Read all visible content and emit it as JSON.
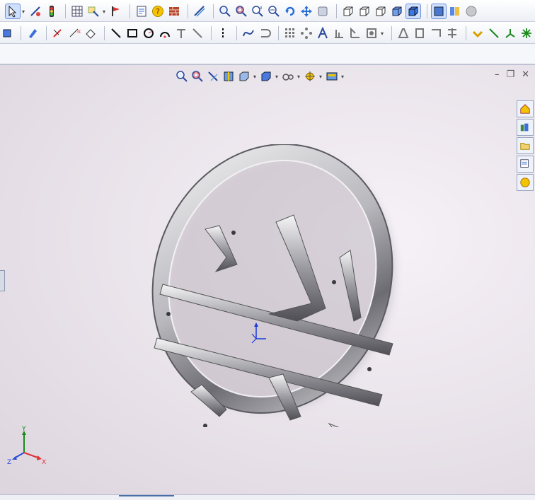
{
  "toolbar_1": {
    "buttons": [
      "select-icon",
      "smart-dimension-icon",
      "traffic-light-icon",
      "grid-icon",
      "sketch-icon",
      "flag-icon",
      "properties-icon",
      "help-icon",
      "wall-icon",
      "measure-icon",
      "zoom-to-fit-icon",
      "zoom-to-area-icon",
      "zoom-in-out-icon",
      "zoom-selection-icon",
      "rotate-icon",
      "pan-icon",
      "roll-icon",
      "view-front-icon",
      "view-back-icon",
      "view-iso-icon",
      "shaded-icon",
      "shaded-edges-icon",
      "display-style-icon",
      "appearance-icon"
    ]
  },
  "toolbar_2": {
    "buttons": [
      "box-icon",
      "pen-icon",
      "sketch-3d-icon",
      "smart-dim-icon",
      "eraser-icon",
      "line-icon",
      "rectangle-icon",
      "circle-icon",
      "arc-icon",
      "trim-icon",
      "offset-icon",
      "centerline-icon",
      "spline-icon",
      "convert-icon",
      "pattern-icon",
      "mirror-icon",
      "text-icon",
      "plane-icon",
      "offset-entities-icon",
      "hole-icon",
      "fillet-icon",
      "chamfer-icon",
      "relation-icon",
      "point-icon",
      "move-icon",
      "asterisk-icon",
      "dimension-icon"
    ]
  },
  "viewport": {
    "triad_labels": {
      "x": "X",
      "y": "Y",
      "z": "Z"
    },
    "window_controls": {
      "minimize": "–",
      "restore": "❐",
      "close": "✕"
    }
  },
  "colors": {
    "accent": "#3a6fd8",
    "toolbar_bg": "#eceff5",
    "viewport_bg": "#ebe5ec",
    "model_metal": "#c8c8cc"
  }
}
